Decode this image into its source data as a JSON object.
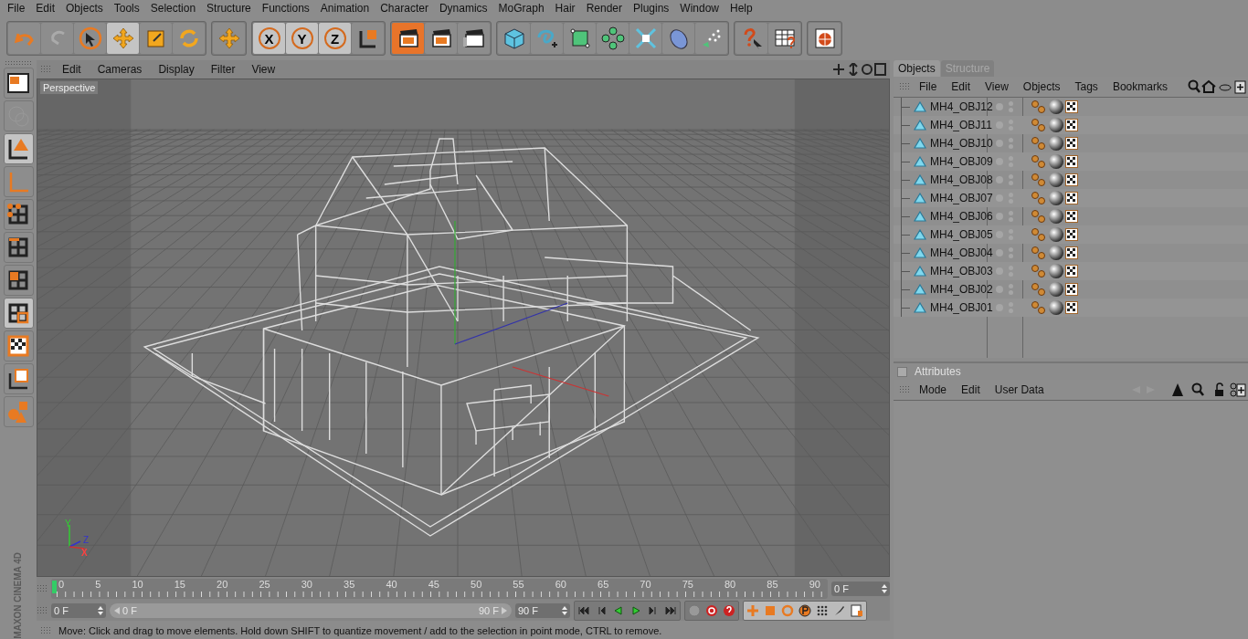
{
  "menu_bar": [
    "File",
    "Edit",
    "Objects",
    "Tools",
    "Selection",
    "Structure",
    "Functions",
    "Animation",
    "Character",
    "Dynamics",
    "MoGraph",
    "Hair",
    "Render",
    "Plugins",
    "Window",
    "Help"
  ],
  "toolbar": [
    [
      {
        "kind": "undo",
        "selected": false
      },
      {
        "kind": "redo",
        "selected": false
      },
      {
        "kind": "select",
        "selected": false
      },
      {
        "kind": "move",
        "selected": true
      },
      {
        "kind": "scale",
        "selected": false
      },
      {
        "kind": "rotate",
        "selected": false
      }
    ],
    [
      {
        "kind": "move",
        "selected": false
      }
    ],
    [
      {
        "kind": "x",
        "label": "X",
        "selected": true
      },
      {
        "kind": "y",
        "label": "Y",
        "selected": true
      },
      {
        "kind": "z",
        "label": "Z",
        "selected": true
      },
      {
        "kind": "coords",
        "selected": false
      }
    ],
    [
      {
        "kind": "render",
        "selected": true
      },
      {
        "kind": "render",
        "selected": false
      },
      {
        "kind": "clapper",
        "selected": false
      }
    ],
    [
      {
        "kind": "cube",
        "selected": false
      },
      {
        "kind": "spline",
        "selected": false
      },
      {
        "kind": "nurbs",
        "selected": false
      },
      {
        "kind": "array",
        "selected": false
      },
      {
        "kind": "deformer",
        "selected": false
      },
      {
        "kind": "disc",
        "selected": false
      },
      {
        "kind": "particles",
        "selected": false
      }
    ],
    [
      {
        "kind": "help",
        "selected": false
      },
      {
        "kind": "table",
        "selected": false
      }
    ],
    [
      {
        "kind": "globe",
        "selected": false
      }
    ]
  ],
  "left_toolbar": [
    {
      "kind": "layout",
      "selected": false
    },
    {
      "kind": "ghost",
      "selected": false
    },
    {
      "kind": "model",
      "selected": true
    },
    {
      "kind": "axis",
      "selected": false
    },
    {
      "kind": "points",
      "selected": false
    },
    {
      "kind": "edges",
      "selected": false
    },
    {
      "kind": "polygons",
      "selected": false
    },
    {
      "kind": "uv",
      "selected": true
    },
    {
      "kind": "texture",
      "selected": false
    },
    {
      "kind": "texaxis",
      "selected": false
    },
    {
      "kind": "shapes",
      "selected": false
    }
  ],
  "viewport": {
    "menu": [
      "Edit",
      "Cameras",
      "Display",
      "Filter",
      "View"
    ],
    "camera": "Perspective",
    "axes": [
      "Y",
      "Z",
      "X"
    ]
  },
  "timeline": {
    "ticks": [
      "0",
      "5",
      "10",
      "15",
      "20",
      "25",
      "30",
      "35",
      "40",
      "45",
      "50",
      "55",
      "60",
      "65",
      "70",
      "75",
      "80",
      "85",
      "90"
    ],
    "current": "0 F",
    "start": "0 F",
    "range": {
      "start": "0 F",
      "end": "90 F",
      "level": 1
    },
    "end": "90 F"
  },
  "brand": "MAXON CINEMA 4D",
  "status_bar": "Move: Click and drag to move elements. Hold down SHIFT to quantize movement / add to the selection in point mode, CTRL to remove.",
  "objects_panel": {
    "tabs": [
      {
        "label": "Objects",
        "selected": true
      },
      {
        "label": "Structure",
        "selected": false
      }
    ],
    "menu": [
      "File",
      "Edit",
      "View",
      "Objects",
      "Tags",
      "Bookmarks"
    ],
    "objects": [
      "MH4_OBJ12",
      "MH4_OBJ11",
      "MH4_OBJ10",
      "MH4_OBJ09",
      "MH4_OBJ08",
      "MH4_OBJ07",
      "MH4_OBJ06",
      "MH4_OBJ05",
      "MH4_OBJ04",
      "MH4_OBJ03",
      "MH4_OBJ02",
      "MH4_OBJ01"
    ]
  },
  "attributes_panel": {
    "title": "Attributes",
    "checked": false,
    "menu": [
      "Mode",
      "Edit",
      "User Data"
    ]
  }
}
